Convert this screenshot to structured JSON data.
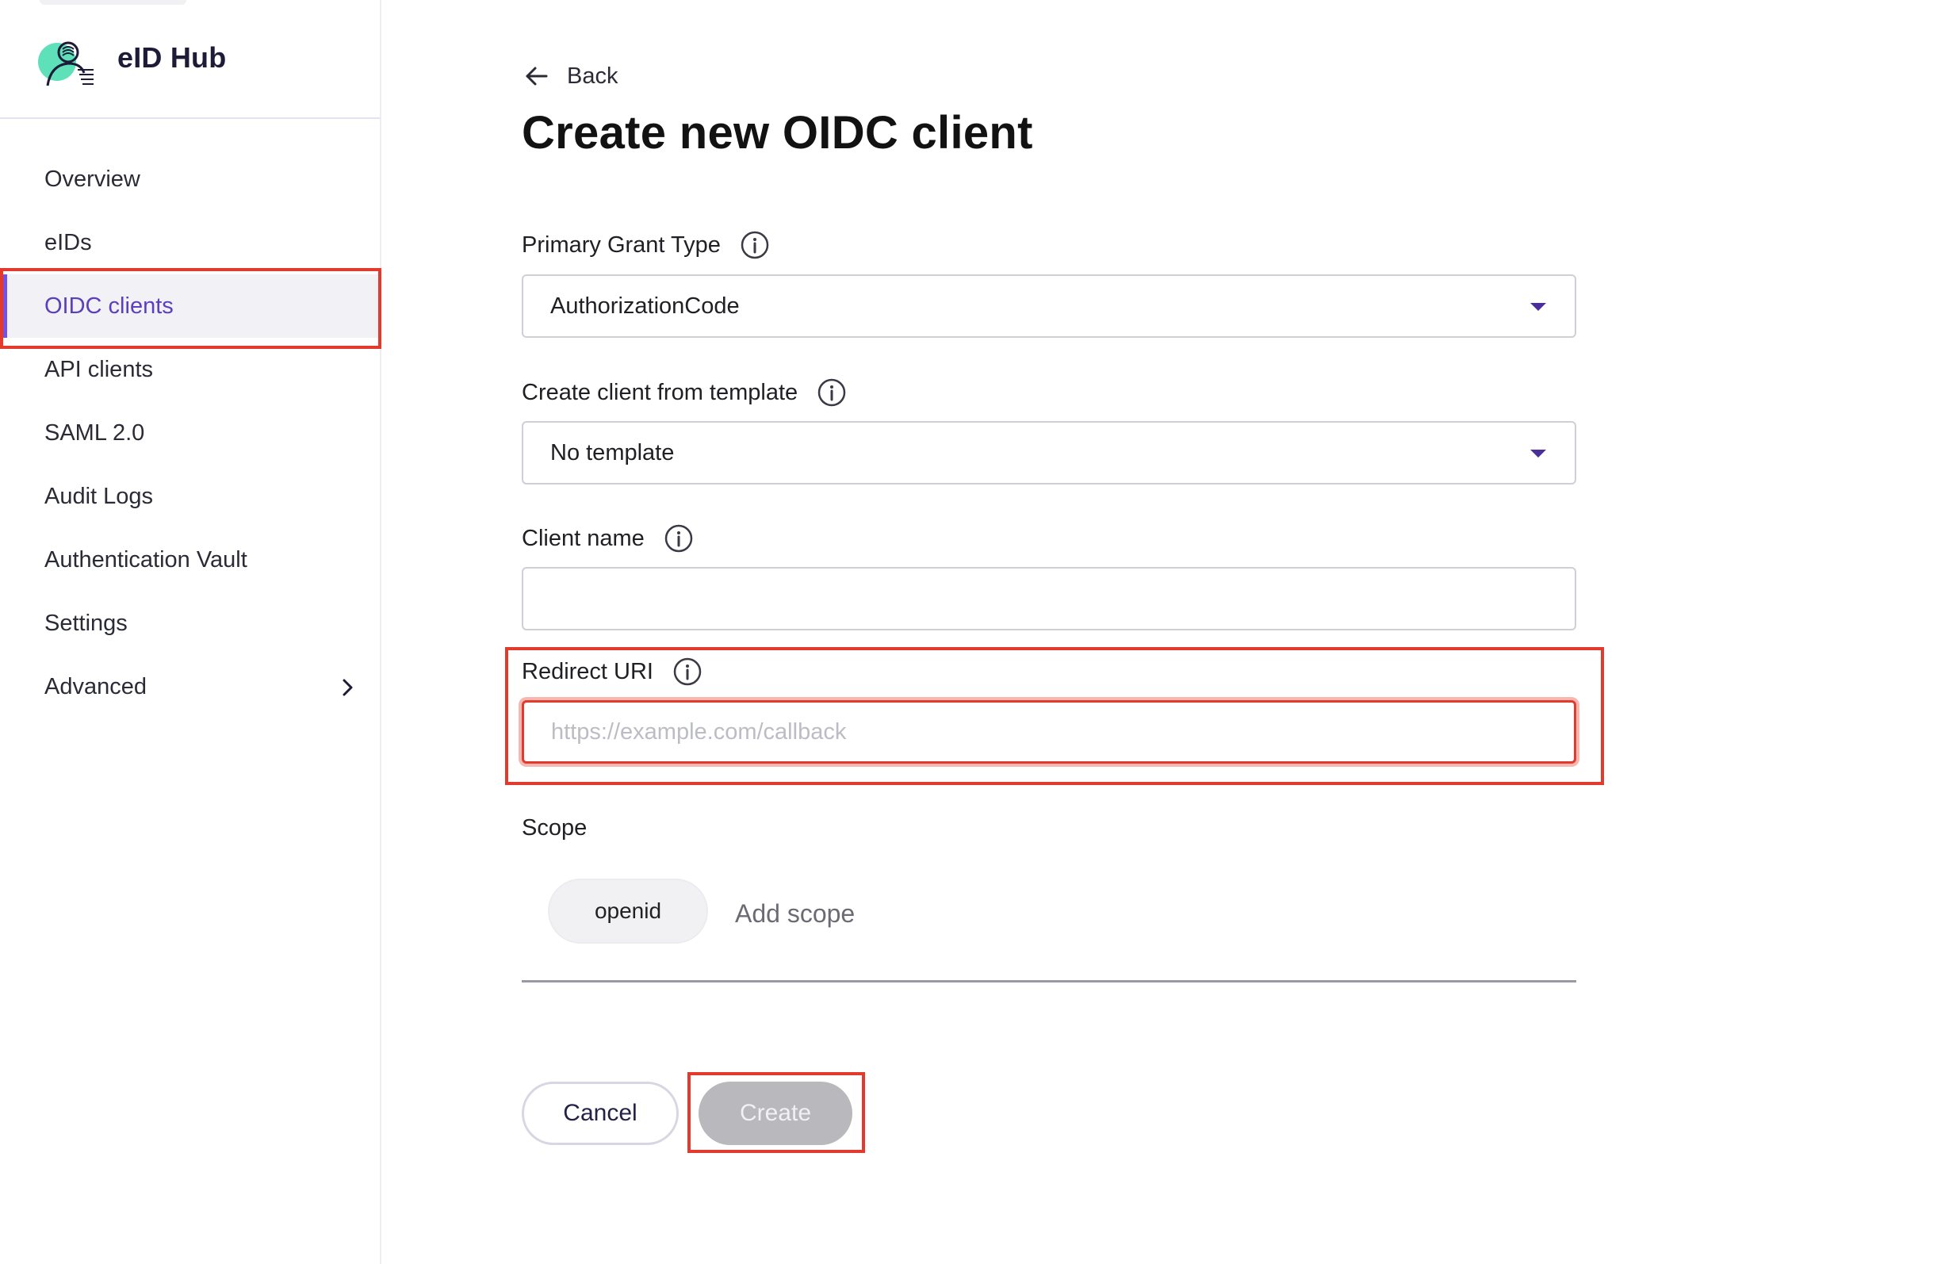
{
  "brand": {
    "name": "eID Hub"
  },
  "sidebar": {
    "items": [
      {
        "label": "Overview"
      },
      {
        "label": "eIDs"
      },
      {
        "label": "OIDC clients",
        "active": true
      },
      {
        "label": "API clients"
      },
      {
        "label": "SAML 2.0"
      },
      {
        "label": "Audit Logs"
      },
      {
        "label": "Authentication Vault"
      },
      {
        "label": "Settings"
      },
      {
        "label": "Advanced",
        "icon": "chevron-right-icon"
      }
    ]
  },
  "header": {
    "back_label": "Back",
    "title": "Create new OIDC client"
  },
  "form": {
    "grant_type": {
      "label": "Primary Grant Type",
      "value": "AuthorizationCode",
      "icon": "info-icon"
    },
    "template": {
      "label": "Create client from template",
      "value": "No template",
      "icon": "info-icon"
    },
    "client_name": {
      "label": "Client name",
      "value": "",
      "icon": "info-icon"
    },
    "redirect_uri": {
      "label": "Redirect URI",
      "value": "",
      "placeholder": "https://example.com/callback",
      "icon": "info-icon"
    },
    "scope": {
      "label": "Scope",
      "chips": [
        "openid"
      ],
      "add_label": "Add scope"
    }
  },
  "actions": {
    "cancel_label": "Cancel",
    "create_label": "Create"
  },
  "colors": {
    "accent": "#7553e0",
    "active_text": "#5b3fbf",
    "highlight": "#e23b2e",
    "disabled_button": "#b8b8bd"
  }
}
